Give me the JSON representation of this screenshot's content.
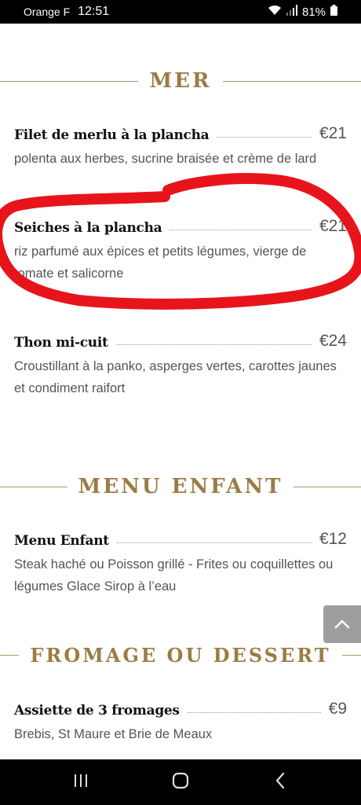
{
  "status_bar": {
    "carrier": "Orange F",
    "time": "12:51",
    "battery": "81%"
  },
  "sections": [
    {
      "title": "MER",
      "items": [
        {
          "name": "Filet de merlu à la plancha",
          "price": "€21",
          "description": "polenta aux herbes, sucrine braisée et crème de lard"
        },
        {
          "name": "Seiches à la plancha",
          "price": "€21",
          "description": "riz parfumé aux épices et petits légumes, vierge de tomate et salicorne"
        },
        {
          "name": "Thon mi-cuit",
          "price": "€24",
          "description": "Croustillant à la panko, asperges vertes, carottes jaunes et condiment raifort"
        }
      ]
    },
    {
      "title": "MENU ENFANT",
      "items": [
        {
          "name": "Menu Enfant",
          "price": "€12",
          "description": "Steak haché ou Poisson grillé - Frites ou coquillettes ou légumes Glace Sirop à l’eau"
        }
      ]
    },
    {
      "title": "FROMAGE OU DESSERT",
      "items": [
        {
          "name": "Assiette de 3 fromages",
          "price": "€9",
          "description": "Brebis, St Maure et Brie de Meaux"
        }
      ]
    }
  ],
  "colors": {
    "section_title": "#9a7c45",
    "annotation": "#e8141c",
    "scroll_button": "#9e9e9e"
  },
  "icons": {
    "scroll_top": "chevron-up-icon",
    "nav_recents": "recents-icon",
    "nav_home": "home-icon",
    "nav_back": "back-icon"
  }
}
